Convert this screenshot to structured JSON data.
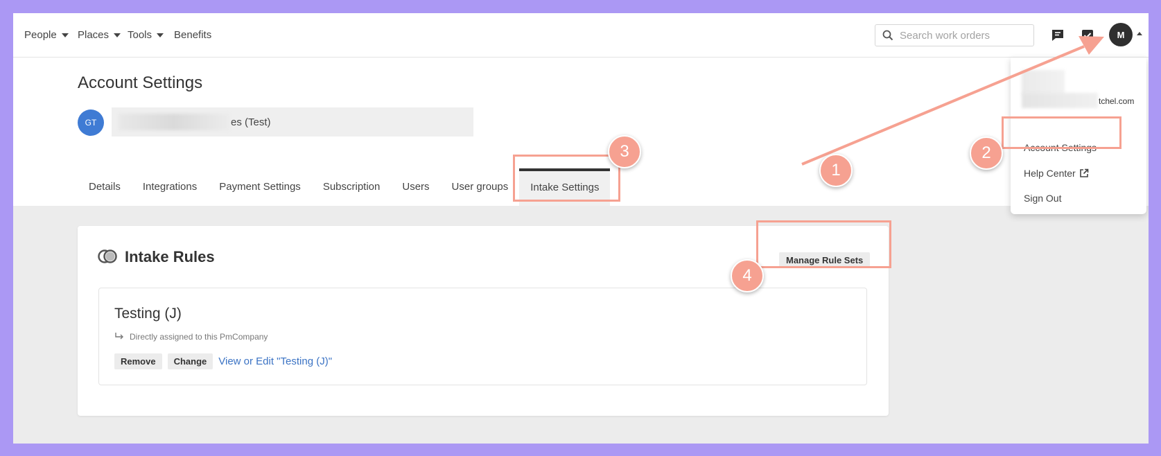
{
  "nav": {
    "people": "People",
    "places": "Places",
    "tools": "Tools",
    "benefits": "Benefits",
    "search_placeholder": "Search work orders",
    "avatar_initial": "M"
  },
  "header": {
    "title": "Account Settings",
    "avatar_initials": "GT",
    "account_name_visible": "es (Test)"
  },
  "tabs": [
    {
      "label": "Details"
    },
    {
      "label": "Integrations"
    },
    {
      "label": "Payment Settings"
    },
    {
      "label": "Subscription"
    },
    {
      "label": "Users"
    },
    {
      "label": "User groups"
    },
    {
      "label": "Intake Settings"
    }
  ],
  "active_tab": "Intake Settings",
  "dropdown": {
    "email_fragment": "tchel.com",
    "items": [
      "Account Settings",
      "Help Center",
      "Sign Out"
    ]
  },
  "intake": {
    "title": "Intake Rules",
    "manage_button": "Manage Rule Sets",
    "rule": {
      "name": "Testing (J)",
      "assignment": "Directly assigned to this PmCompany",
      "remove": "Remove",
      "change": "Change",
      "link": "View or Edit \"Testing (J)\""
    }
  },
  "annotations": {
    "steps": [
      "1",
      "2",
      "3",
      "4"
    ],
    "color": "#f6a191"
  }
}
